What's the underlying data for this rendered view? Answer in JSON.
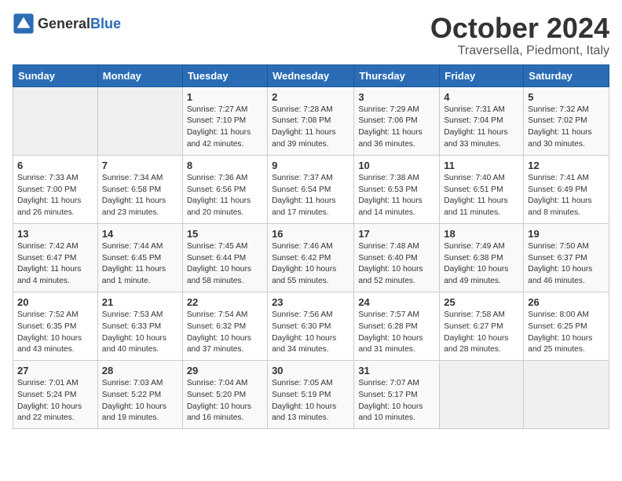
{
  "logo": {
    "general": "General",
    "blue": "Blue"
  },
  "title": "October 2024",
  "location": "Traversella, Piedmont, Italy",
  "weekdays": [
    "Sunday",
    "Monday",
    "Tuesday",
    "Wednesday",
    "Thursday",
    "Friday",
    "Saturday"
  ],
  "weeks": [
    [
      {
        "day": "",
        "info": ""
      },
      {
        "day": "",
        "info": ""
      },
      {
        "day": "1",
        "info": "Sunrise: 7:27 AM\nSunset: 7:10 PM\nDaylight: 11 hours\nand 42 minutes."
      },
      {
        "day": "2",
        "info": "Sunrise: 7:28 AM\nSunset: 7:08 PM\nDaylight: 11 hours\nand 39 minutes."
      },
      {
        "day": "3",
        "info": "Sunrise: 7:29 AM\nSunset: 7:06 PM\nDaylight: 11 hours\nand 36 minutes."
      },
      {
        "day": "4",
        "info": "Sunrise: 7:31 AM\nSunset: 7:04 PM\nDaylight: 11 hours\nand 33 minutes."
      },
      {
        "day": "5",
        "info": "Sunrise: 7:32 AM\nSunset: 7:02 PM\nDaylight: 11 hours\nand 30 minutes."
      }
    ],
    [
      {
        "day": "6",
        "info": "Sunrise: 7:33 AM\nSunset: 7:00 PM\nDaylight: 11 hours\nand 26 minutes."
      },
      {
        "day": "7",
        "info": "Sunrise: 7:34 AM\nSunset: 6:58 PM\nDaylight: 11 hours\nand 23 minutes."
      },
      {
        "day": "8",
        "info": "Sunrise: 7:36 AM\nSunset: 6:56 PM\nDaylight: 11 hours\nand 20 minutes."
      },
      {
        "day": "9",
        "info": "Sunrise: 7:37 AM\nSunset: 6:54 PM\nDaylight: 11 hours\nand 17 minutes."
      },
      {
        "day": "10",
        "info": "Sunrise: 7:38 AM\nSunset: 6:53 PM\nDaylight: 11 hours\nand 14 minutes."
      },
      {
        "day": "11",
        "info": "Sunrise: 7:40 AM\nSunset: 6:51 PM\nDaylight: 11 hours\nand 11 minutes."
      },
      {
        "day": "12",
        "info": "Sunrise: 7:41 AM\nSunset: 6:49 PM\nDaylight: 11 hours\nand 8 minutes."
      }
    ],
    [
      {
        "day": "13",
        "info": "Sunrise: 7:42 AM\nSunset: 6:47 PM\nDaylight: 11 hours\nand 4 minutes."
      },
      {
        "day": "14",
        "info": "Sunrise: 7:44 AM\nSunset: 6:45 PM\nDaylight: 11 hours\nand 1 minute."
      },
      {
        "day": "15",
        "info": "Sunrise: 7:45 AM\nSunset: 6:44 PM\nDaylight: 10 hours\nand 58 minutes."
      },
      {
        "day": "16",
        "info": "Sunrise: 7:46 AM\nSunset: 6:42 PM\nDaylight: 10 hours\nand 55 minutes."
      },
      {
        "day": "17",
        "info": "Sunrise: 7:48 AM\nSunset: 6:40 PM\nDaylight: 10 hours\nand 52 minutes."
      },
      {
        "day": "18",
        "info": "Sunrise: 7:49 AM\nSunset: 6:38 PM\nDaylight: 10 hours\nand 49 minutes."
      },
      {
        "day": "19",
        "info": "Sunrise: 7:50 AM\nSunset: 6:37 PM\nDaylight: 10 hours\nand 46 minutes."
      }
    ],
    [
      {
        "day": "20",
        "info": "Sunrise: 7:52 AM\nSunset: 6:35 PM\nDaylight: 10 hours\nand 43 minutes."
      },
      {
        "day": "21",
        "info": "Sunrise: 7:53 AM\nSunset: 6:33 PM\nDaylight: 10 hours\nand 40 minutes."
      },
      {
        "day": "22",
        "info": "Sunrise: 7:54 AM\nSunset: 6:32 PM\nDaylight: 10 hours\nand 37 minutes."
      },
      {
        "day": "23",
        "info": "Sunrise: 7:56 AM\nSunset: 6:30 PM\nDaylight: 10 hours\nand 34 minutes."
      },
      {
        "day": "24",
        "info": "Sunrise: 7:57 AM\nSunset: 6:28 PM\nDaylight: 10 hours\nand 31 minutes."
      },
      {
        "day": "25",
        "info": "Sunrise: 7:58 AM\nSunset: 6:27 PM\nDaylight: 10 hours\nand 28 minutes."
      },
      {
        "day": "26",
        "info": "Sunrise: 8:00 AM\nSunset: 6:25 PM\nDaylight: 10 hours\nand 25 minutes."
      }
    ],
    [
      {
        "day": "27",
        "info": "Sunrise: 7:01 AM\nSunset: 5:24 PM\nDaylight: 10 hours\nand 22 minutes."
      },
      {
        "day": "28",
        "info": "Sunrise: 7:03 AM\nSunset: 5:22 PM\nDaylight: 10 hours\nand 19 minutes."
      },
      {
        "day": "29",
        "info": "Sunrise: 7:04 AM\nSunset: 5:20 PM\nDaylight: 10 hours\nand 16 minutes."
      },
      {
        "day": "30",
        "info": "Sunrise: 7:05 AM\nSunset: 5:19 PM\nDaylight: 10 hours\nand 13 minutes."
      },
      {
        "day": "31",
        "info": "Sunrise: 7:07 AM\nSunset: 5:17 PM\nDaylight: 10 hours\nand 10 minutes."
      },
      {
        "day": "",
        "info": ""
      },
      {
        "day": "",
        "info": ""
      }
    ]
  ]
}
